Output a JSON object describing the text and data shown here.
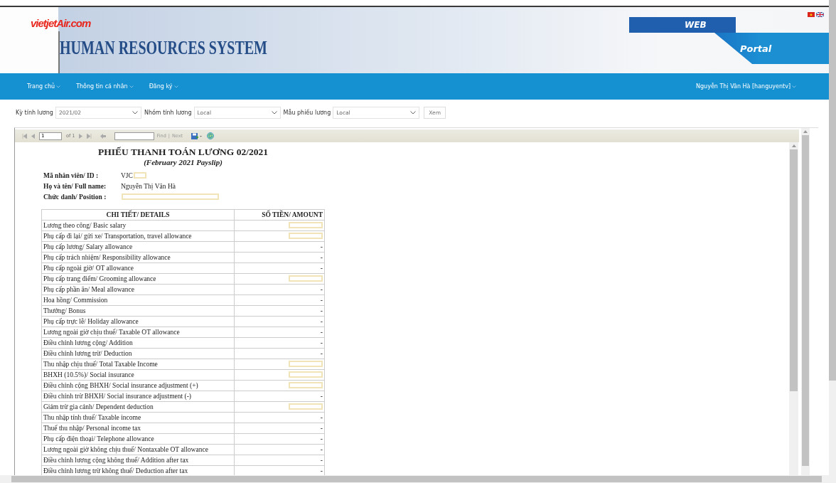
{
  "header": {
    "logo": "vietjetAir.com",
    "title": "HUMAN RESOURCES SYSTEM",
    "badge_top": "WEB",
    "badge_bottom": "Portal"
  },
  "nav": {
    "items": [
      {
        "label": "Trang chủ",
        "has_dropdown": true
      },
      {
        "label": "Thông tin cá nhân",
        "has_dropdown": true
      },
      {
        "label": "Đăng ký",
        "has_dropdown": true
      }
    ],
    "user": "Nguyễn Thị Vân Hà [hanguyentv]"
  },
  "filters": [
    {
      "label": "Kỳ tính lương",
      "value": "2021/02"
    },
    {
      "label": "Nhóm tính lương",
      "value": "Local"
    },
    {
      "label": "Mẫu phiếu lương",
      "value": "Local"
    }
  ],
  "view_button": "Xem",
  "toolbar": {
    "page": "1",
    "page_count": "of 1",
    "find": "Find",
    "separator": "|",
    "next": "Next"
  },
  "report": {
    "title": "PHIẾU THANH TOÁN LƯƠNG 02/2021",
    "subtitle": "(February 2021 Payslip)",
    "info": [
      {
        "label": "Mã nhân viên/ ID :",
        "value": "VJC",
        "redacted": true
      },
      {
        "label": "Họ và tên/ Full name:",
        "value": "Nguyễn Thị Vân Hà",
        "redacted": false
      },
      {
        "label": "Chức danh/ Position :",
        "redacted": true
      }
    ],
    "columns": [
      "CHI TIẾT/ DETAILS",
      "SỐ TIỀN/ AMOUNT"
    ],
    "rows": [
      {
        "detail": "Lương theo công/ Basic salary",
        "redacted": true
      },
      {
        "detail": "Phụ cấp đi lại/ gửi xe/ Transportation, travel allowance",
        "redacted": true
      },
      {
        "detail": "Phụ cấp lương/ Salary allowance",
        "amount": "-",
        "redacted": false
      },
      {
        "detail": "Phụ cấp trách nhiệm/ Responsibility allowance",
        "amount": "-",
        "redacted": false
      },
      {
        "detail": "Phụ cấp ngoài giờ/ OT allowance",
        "amount": "-",
        "redacted": false
      },
      {
        "detail": "Phụ cấp trang điểm/ Grooming allowance",
        "redacted": true
      },
      {
        "detail": "Phụ cấp phần ăn/ Meal allowance",
        "amount": "-",
        "redacted": false
      },
      {
        "detail": "Hoa hồng/ Commission",
        "amount": "-",
        "redacted": false
      },
      {
        "detail": "Thưởng/ Bonus",
        "amount": "-",
        "redacted": false
      },
      {
        "detail": "Phụ cấp trực lễ/ Holiday allowance",
        "amount": "-",
        "redacted": false
      },
      {
        "detail": "Lương ngoài giờ chịu thuế/ Taxable OT allowance",
        "amount": "-",
        "redacted": false
      },
      {
        "detail": "Điều chỉnh lương cộng/ Addition",
        "amount": "-",
        "redacted": false
      },
      {
        "detail": "Điều chỉnh lương trừ/ Deduction",
        "amount": "-",
        "redacted": false
      },
      {
        "detail": "Thu nhập chịu thuế/ Total Taxable Income",
        "redacted": true
      },
      {
        "detail": "BHXH (10.5%)/ Social insurance",
        "redacted": true
      },
      {
        "detail": "Điều chỉnh cộng BHXH/ Social insurance adjustment (+)",
        "redacted": true
      },
      {
        "detail": "Điều chỉnh trừ BHXH/ Social insurance adjustment (-)",
        "amount": "-",
        "redacted": false
      },
      {
        "detail": "Giảm trừ gia cảnh/ Dependent deduction",
        "redacted": true
      },
      {
        "detail": "Thu nhập tính thuế/ Taxable income",
        "amount": "-",
        "redacted": false
      },
      {
        "detail": "Thuế thu nhập/ Personal income tax",
        "amount": "-",
        "redacted": false
      },
      {
        "detail": "Phụ cấp điện thoại/ Telephone allowance",
        "amount": "-",
        "redacted": false
      },
      {
        "detail": "Lương ngoài giờ không chịu thuế/ Nontaxable OT allowance",
        "amount": "-",
        "redacted": false
      },
      {
        "detail": "Điều chỉnh lương cộng không thuế/ Addition after tax",
        "amount": "-",
        "redacted": false
      },
      {
        "detail": "Điều chỉnh lương trừ không thuế/ Deduction after tax",
        "amount": "-",
        "redacted": false
      }
    ]
  }
}
